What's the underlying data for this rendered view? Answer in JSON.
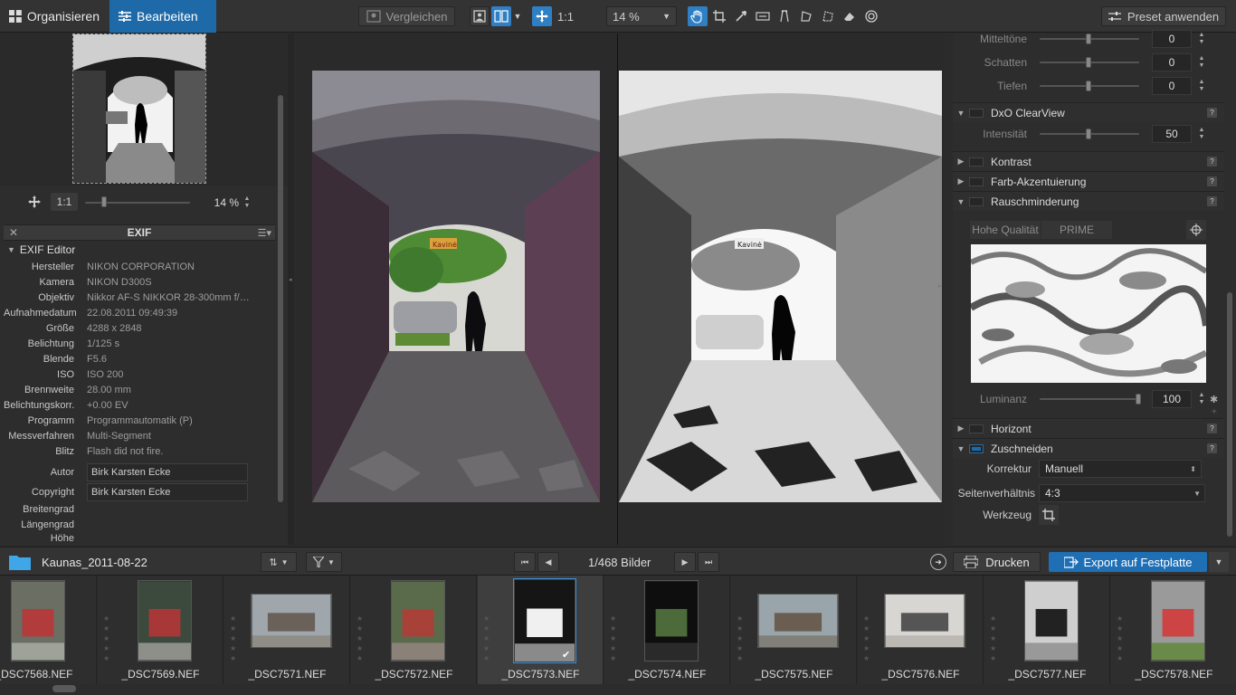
{
  "topbar": {
    "tab_organize": "Organisieren",
    "tab_edit": "Bearbeiten",
    "compare_label": "Vergleichen",
    "ratio_label": "1:1",
    "zoom_value": "14 %",
    "preset_label": "Preset anwenden"
  },
  "navigator": {
    "ratio_label": "1:1",
    "zoom_value": "14 %"
  },
  "exif": {
    "panel_title": "EXIF",
    "section_title": "EXIF Editor",
    "rows": [
      {
        "key": "Hersteller",
        "value": "NIKON CORPORATION"
      },
      {
        "key": "Kamera",
        "value": "NIKON D300S"
      },
      {
        "key": "Objektiv",
        "value": "Nikkor AF-S NIKKOR 28-300mm f/…"
      },
      {
        "key": "Aufnahmedatum",
        "value": "22.08.2011 09:49:39"
      },
      {
        "key": "Größe",
        "value": "4288 x 2848"
      },
      {
        "key": "Belichtung",
        "value": "1/125 s"
      },
      {
        "key": "Blende",
        "value": "F5.6"
      },
      {
        "key": "ISO",
        "value": "ISO 200"
      },
      {
        "key": "Brennweite",
        "value": "28.00 mm"
      },
      {
        "key": "Belichtungskorr.",
        "value": "+0.00 EV"
      },
      {
        "key": "Programm",
        "value": "Programmautomatik (P)"
      },
      {
        "key": "Messverfahren",
        "value": "Multi-Segment"
      },
      {
        "key": "Blitz",
        "value": "Flash did not fire."
      }
    ],
    "author_label": "Autor",
    "author_value": "Birk Karsten Ecke",
    "copyright_label": "Copyright",
    "copyright_value": "Birk Karsten Ecke",
    "latitude_label": "Breitengrad",
    "longitude_label": "Längengrad",
    "altitude_label": "Höhe"
  },
  "viewer": {
    "sign_left": "Kavinė",
    "sign_right": "Kavinė"
  },
  "rightpanel": {
    "tone_rows": [
      {
        "label": "Mitteltöne",
        "value": "0"
      },
      {
        "label": "Schatten",
        "value": "0"
      },
      {
        "label": "Tiefen",
        "value": "0"
      }
    ],
    "clearview_title": "DxO ClearView",
    "intensity_label": "Intensität",
    "intensity_value": "50",
    "contrast_title": "Kontrast",
    "color_accent_title": "Farb-Akzentuierung",
    "noise_title": "Rauschminderung",
    "mode_hq": "Hohe Qualität",
    "mode_prime": "PRIME",
    "luminance_label": "Luminanz",
    "luminance_value": "100",
    "horizon_title": "Horizont",
    "crop_title": "Zuschneiden",
    "correction_label": "Korrektur",
    "correction_value": "Manuell",
    "aspect_label": "Seitenverhältnis",
    "aspect_value": "4:3",
    "tool_label": "Werkzeug",
    "help_glyph": "?"
  },
  "browser": {
    "folder_name": "Kaunas_2011-08-22",
    "counter": "1/468 Bilder",
    "print_label": "Drucken",
    "export_label": "Export auf Festplatte"
  },
  "filmstrip": [
    {
      "name": "_DSC7568.NEF"
    },
    {
      "name": "_DSC7569.NEF"
    },
    {
      "name": "_DSC7571.NEF"
    },
    {
      "name": "_DSC7572.NEF"
    },
    {
      "name": "_DSC7573.NEF"
    },
    {
      "name": "_DSC7574.NEF"
    },
    {
      "name": "_DSC7575.NEF"
    },
    {
      "name": "_DSC7576.NEF"
    },
    {
      "name": "_DSC7577.NEF"
    },
    {
      "name": "_DSC7578.NEF"
    }
  ],
  "colors": {
    "accent": "#1e6aa8",
    "export_button": "#1f6fb5",
    "panel_bg": "#2d2d2d"
  }
}
